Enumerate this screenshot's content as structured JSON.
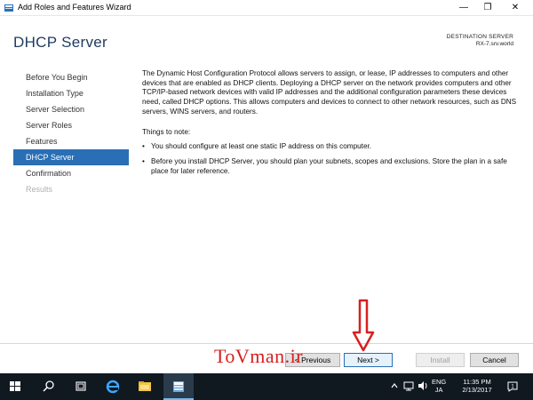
{
  "window": {
    "title": "Add Roles and Features Wizard",
    "minimize_glyph": "—",
    "maximize_glyph": "❐",
    "close_glyph": "✕"
  },
  "header": {
    "page_title": "DHCP Server",
    "destination_label": "DESTINATION SERVER",
    "destination_server": "RX-7.srv.world"
  },
  "nav": {
    "items": [
      {
        "label": "Before You Begin",
        "state": "normal"
      },
      {
        "label": "Installation Type",
        "state": "normal"
      },
      {
        "label": "Server Selection",
        "state": "normal"
      },
      {
        "label": "Server Roles",
        "state": "normal"
      },
      {
        "label": "Features",
        "state": "normal"
      },
      {
        "label": "DHCP Server",
        "state": "active"
      },
      {
        "label": "Confirmation",
        "state": "normal"
      },
      {
        "label": "Results",
        "state": "disabled"
      }
    ]
  },
  "content": {
    "intro": "The Dynamic Host Configuration Protocol allows servers to assign, or lease, IP addresses to computers and other devices that are enabled as DHCP clients. Deploying a DHCP server on the network provides computers and other TCP/IP-based network devices with valid IP addresses and the additional configuration parameters these devices need, called DHCP options. This allows computers and devices to connect to other network resources, such as DNS servers, WINS servers, and routers.",
    "notes_title": "Things to note:",
    "bullet_glyph": "•",
    "notes": [
      "You should configure at least one static IP address on this computer.",
      "Before you install DHCP Server, you should plan your subnets, scopes and exclusions. Store the plan in a safe place for later reference."
    ]
  },
  "footer": {
    "previous_label": "< Previous",
    "next_label": "Next >",
    "install_label": "Install",
    "cancel_label": "Cancel"
  },
  "overlay": {
    "watermark": "ToVman.ir",
    "color": "#d62020"
  },
  "taskbar": {
    "icons": [
      "windows-start-icon",
      "search-icon",
      "task-view-icon",
      "internet-explorer-icon",
      "file-explorer-icon",
      "server-manager-icon"
    ],
    "tray_icons": [
      "chevron-up-icon",
      "network-icon",
      "volume-icon"
    ],
    "lang_line1": "ENG",
    "lang_line2": "JA",
    "time": "11:35 PM",
    "date": "2/13/2017",
    "notification_count": "1"
  },
  "colors": {
    "accent": "#2a6fb5",
    "title_color": "#1f3a5f",
    "taskbar": "#101820"
  }
}
